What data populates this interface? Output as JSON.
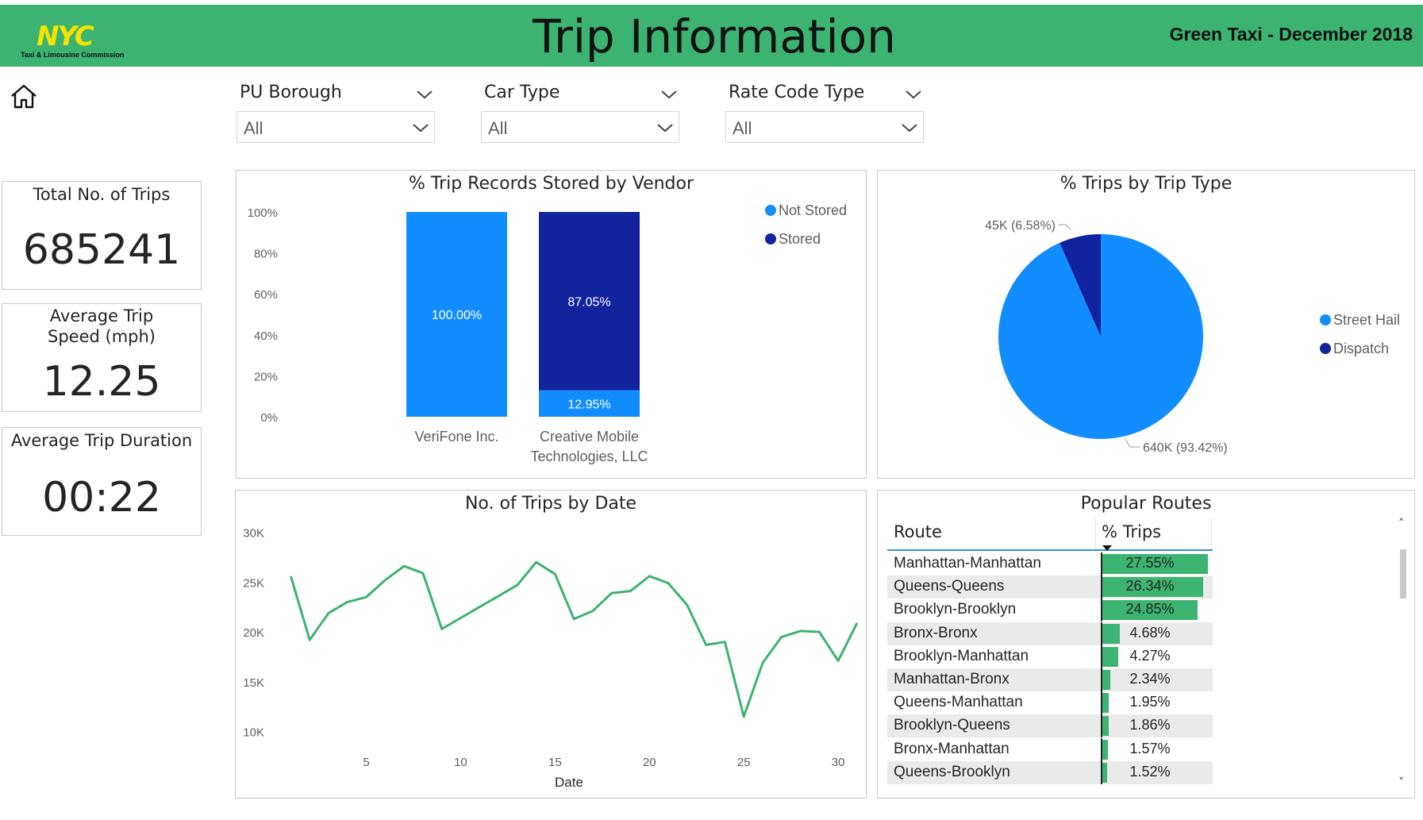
{
  "header": {
    "logo_mark": "NYC",
    "logo_sub": "Taxi & Limousine Commission",
    "title": "Trip Information",
    "subtitle": "Green Taxi - December 2018",
    "brand_color": "#3cb371"
  },
  "nav": {
    "home_icon": "home-icon"
  },
  "filters": [
    {
      "label": "PU Borough",
      "value": "All"
    },
    {
      "label": "Car Type",
      "value": "All"
    },
    {
      "label": "Rate Code Type",
      "value": "All"
    }
  ],
  "kpis": [
    {
      "title": "Total No. of Trips",
      "value": "685241"
    },
    {
      "title": "Average Trip Speed (mph)",
      "value": "12.25"
    },
    {
      "title": "Average Trip Duration",
      "value": "00:22"
    }
  ],
  "vendor_chart": {
    "title": "% Trip Records Stored by Vendor",
    "chart_data": {
      "type": "bar",
      "stacked": true,
      "categories": [
        "VeriFone Inc.",
        "Creative Mobile Technologies, LLC"
      ],
      "series": [
        {
          "name": "Not Stored",
          "values": [
            100.0,
            12.95
          ],
          "labels": [
            "100.00%",
            "12.95%"
          ],
          "color": "#118dff"
        },
        {
          "name": "Stored",
          "values": [
            0.0,
            87.05
          ],
          "labels": [
            "",
            "87.05%"
          ],
          "color": "#12239e"
        }
      ],
      "y_ticks": [
        "0%",
        "20%",
        "40%",
        "60%",
        "80%",
        "100%"
      ],
      "ylim": [
        0,
        100
      ],
      "legend": "top-right"
    }
  },
  "trip_type_chart": {
    "title": "% Trips by Trip Type",
    "chart_data": {
      "type": "pie",
      "slices": [
        {
          "name": "Street Hail",
          "value": 93.42,
          "label": "640K (93.42%)",
          "color": "#118dff"
        },
        {
          "name": "Dispatch",
          "value": 6.58,
          "label": "45K (6.58%)",
          "color": "#12239e"
        }
      ],
      "legend": "right"
    }
  },
  "date_chart": {
    "title": "No. of Trips by Date",
    "chart_data": {
      "type": "line",
      "xlabel": "Date",
      "ylabel": "",
      "x": [
        1,
        2,
        3,
        4,
        5,
        6,
        7,
        8,
        9,
        10,
        11,
        12,
        13,
        14,
        15,
        16,
        17,
        18,
        19,
        20,
        21,
        22,
        23,
        24,
        25,
        26,
        27,
        28,
        29,
        30,
        31
      ],
      "y": [
        25600,
        19200,
        21900,
        23000,
        23500,
        25200,
        26600,
        25900,
        20300,
        21400,
        22500,
        23600,
        24700,
        27000,
        25800,
        21300,
        22100,
        23900,
        24100,
        25600,
        24900,
        22700,
        18700,
        19000,
        11500,
        16900,
        19500,
        20100,
        20000,
        17100,
        20900
      ],
      "x_ticks": [
        "5",
        "10",
        "15",
        "20",
        "25",
        "30"
      ],
      "y_ticks": [
        "10K",
        "15K",
        "20K",
        "25K",
        "30K"
      ],
      "xlim": [
        0.1,
        31.3
      ],
      "ylim": [
        8700,
        31000
      ],
      "color": "#3cb371"
    }
  },
  "routes": {
    "title": "Popular Routes",
    "columns": [
      "Route",
      "% Trips"
    ],
    "rows": [
      {
        "route": "Manhattan-Manhattan",
        "pct": "27.55%",
        "value": 27.55
      },
      {
        "route": "Queens-Queens",
        "pct": "26.34%",
        "value": 26.34
      },
      {
        "route": "Brooklyn-Brooklyn",
        "pct": "24.85%",
        "value": 24.85
      },
      {
        "route": "Bronx-Bronx",
        "pct": "4.68%",
        "value": 4.68
      },
      {
        "route": "Brooklyn-Manhattan",
        "pct": "4.27%",
        "value": 4.27
      },
      {
        "route": "Manhattan-Bronx",
        "pct": "2.34%",
        "value": 2.34
      },
      {
        "route": "Queens-Manhattan",
        "pct": "1.95%",
        "value": 1.95
      },
      {
        "route": "Brooklyn-Queens",
        "pct": "1.86%",
        "value": 1.86
      },
      {
        "route": "Bronx-Manhattan",
        "pct": "1.57%",
        "value": 1.57
      },
      {
        "route": "Queens-Brooklyn",
        "pct": "1.52%",
        "value": 1.52
      }
    ],
    "bar_color": "#3cb371"
  }
}
